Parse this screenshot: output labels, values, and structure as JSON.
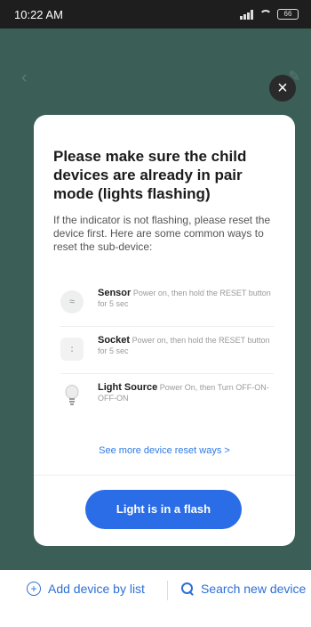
{
  "status_bar": {
    "time": "10:22 AM",
    "battery": "66"
  },
  "modal": {
    "title": "Please make sure the child devices are already in pair mode (lights flashing)",
    "description": "If the indicator is not flashing, please reset the device first. Here are some common ways to reset the sub-device:",
    "items": [
      {
        "name": "Sensor",
        "instruction": "Power on, then hold the RESET button for 5 sec",
        "icon": "sensor-icon"
      },
      {
        "name": "Socket",
        "instruction": "Power on, then hold the RESET button for 5 sec",
        "icon": "socket-icon"
      },
      {
        "name": "Light Source",
        "instruction": "Power On, then Turn OFF-ON-OFF-ON",
        "icon": "bulb-icon"
      }
    ],
    "more_link": "See more device reset ways >",
    "primary_button": "Light is in a flash"
  },
  "bottom_bar": {
    "add_label": "Add device by list",
    "search_label": "Search new device"
  },
  "colors": {
    "accent": "#2b6de6",
    "backdrop": "#3b5e57"
  }
}
